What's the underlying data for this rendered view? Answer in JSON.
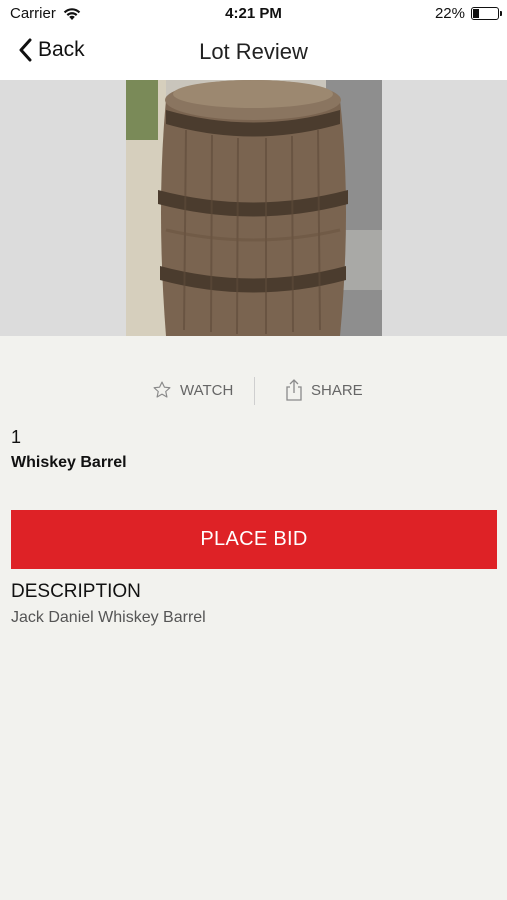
{
  "status_bar": {
    "carrier": "Carrier",
    "time": "4:21 PM",
    "battery_percent": "22%",
    "battery_level": 0.22
  },
  "nav": {
    "back_label": "Back",
    "title": "Lot Review"
  },
  "actions": {
    "watch_label": "WATCH",
    "share_label": "SHARE"
  },
  "lot": {
    "number": "1",
    "name": "Whiskey Barrel",
    "bid_button_label": "PLACE BID",
    "description_heading": "DESCRIPTION",
    "description": "Jack Daniel Whiskey Barrel"
  },
  "colors": {
    "accent": "#de2226",
    "background": "#f2f2ee"
  }
}
